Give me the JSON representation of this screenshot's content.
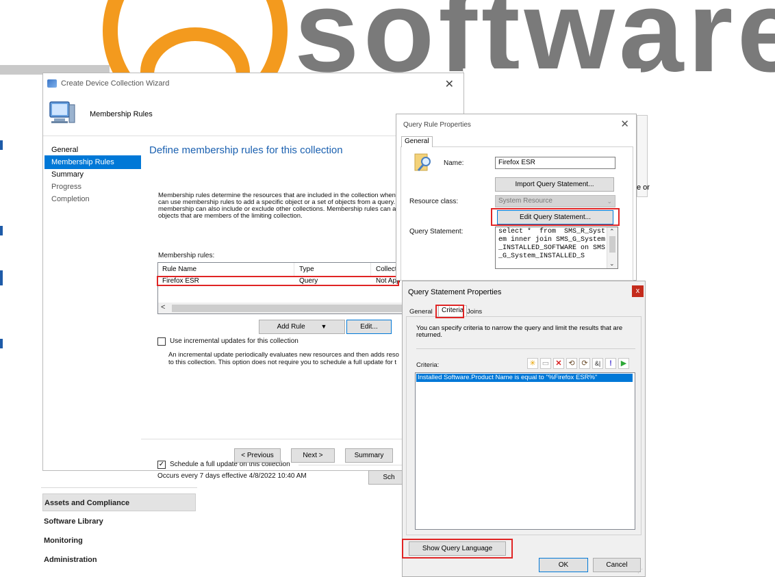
{
  "background": {
    "logo_word": "software",
    "brand_color": "#f39a1e"
  },
  "console": {
    "nav": [
      "Assets and Compliance",
      "Software Library",
      "Monitoring",
      "Administration"
    ],
    "edge_text": "e or"
  },
  "wizard": {
    "title": "Create Device Collection Wizard",
    "header_title": "Membership Rules",
    "steps": [
      "General",
      "Membership Rules",
      "Summary",
      "Progress",
      "Completion"
    ],
    "active_step": "Membership Rules",
    "heading": "Define membership rules for this collection",
    "description": "Membership rules determine the resources that are included in the collection when i\ncan use membership rules to add a specific object or a set of objects from a query. Y\nmembership can also include or exclude other collections. Membership rules can ad\nobjects that are members of the limiting collection.",
    "rules_label": "Membership rules:",
    "rules_columns": [
      "Rule Name",
      "Type",
      "Collecti"
    ],
    "rules_rows": [
      {
        "name": "Firefox ESR",
        "type": "Query",
        "collection": "Not App"
      }
    ],
    "add_rule_button": "Add Rule",
    "edit_button": "Edit...",
    "incremental_label": "Use incremental updates for this collection",
    "incremental_checked": false,
    "incremental_desc": "An incremental update periodically evaluates new resources and then adds reso\nto this collection. This option does not require you to schedule a full update for t",
    "schedule_label": "Schedule a full update on this collection",
    "schedule_checked": true,
    "schedule_desc": "Occurs every 7 days effective 4/8/2022 10:40 AM",
    "schedule_button": "Sch",
    "prev_button": "< Previous",
    "next_button": "Next >",
    "summary_button": "Summary"
  },
  "query_rule": {
    "title": "Query Rule Properties",
    "tab": "General",
    "name_label": "Name:",
    "name_value": "Firefox ESR",
    "import_button": "Import Query Statement...",
    "resource_class_label": "Resource class:",
    "resource_class_value": "System Resource",
    "edit_query_button": "Edit Query Statement...",
    "query_statement_label": "Query Statement:",
    "query_text": "select *  from  SMS_R_System inner join SMS_G_System_INSTALLED_SOFTWARE on SMS_G_System_INSTALLED_S"
  },
  "query_statement": {
    "title": "Query Statement Properties",
    "tabs": [
      "General",
      "Criteria",
      "Joins"
    ],
    "active_tab": "Criteria",
    "description": "You can specify criteria to narrow the query and limit the results that are returned.",
    "criteria_label": "Criteria:",
    "toolbar_icons": [
      "new-criterion-icon",
      "properties-icon",
      "delete-icon",
      "group-icon",
      "ungroup-icon",
      "and-or-icon",
      "not-icon",
      "run-icon"
    ],
    "toolbar_glyphs": [
      "✳",
      "▭",
      "✕",
      "⟲",
      "⟳",
      "&|",
      "!",
      "▶"
    ],
    "criteria_rows": [
      "Installed Software.Product Name is equal to \"%Firefox ESR%\""
    ],
    "show_query_language_button": "Show Query Language",
    "ok_button": "OK",
    "cancel_button": "Cancel"
  },
  "colors": {
    "highlight_red": "#e02424",
    "selection_blue": "#0078d7",
    "heading_blue": "#1a60b0"
  }
}
